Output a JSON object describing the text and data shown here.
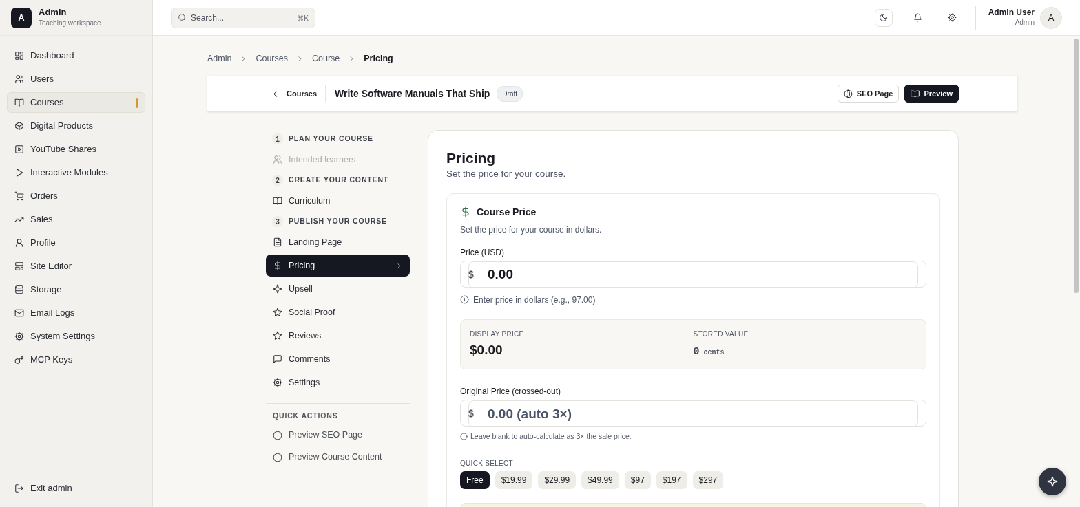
{
  "brand": {
    "logo": "A",
    "name": "Admin",
    "subtitle": "Teaching workspace"
  },
  "sidebar": {
    "items": [
      {
        "label": "Dashboard",
        "selected": false
      },
      {
        "label": "Users",
        "selected": false
      },
      {
        "label": "Courses",
        "selected": true
      },
      {
        "label": "Digital Products",
        "selected": false
      },
      {
        "label": "YouTube Shares",
        "selected": false
      },
      {
        "label": "Interactive Modules",
        "selected": false
      },
      {
        "label": "Orders",
        "selected": false
      },
      {
        "label": "Sales",
        "selected": false
      },
      {
        "label": "Profile",
        "selected": false
      },
      {
        "label": "Site Editor",
        "selected": false
      },
      {
        "label": "Storage",
        "selected": false
      },
      {
        "label": "Email Logs",
        "selected": false
      },
      {
        "label": "System Settings",
        "selected": false
      },
      {
        "label": "MCP Keys",
        "selected": false
      }
    ],
    "footer": {
      "label": "Exit admin"
    }
  },
  "topbar": {
    "search": {
      "placeholder": "Search...",
      "shortcut": "⌘K"
    },
    "user": {
      "name": "Admin User",
      "role": "Admin",
      "avatar": "A"
    }
  },
  "breadcrumb": [
    {
      "label": "Admin",
      "current": false
    },
    {
      "label": "Courses",
      "current": false
    },
    {
      "label": "Course",
      "current": false
    },
    {
      "label": "Pricing",
      "current": true
    }
  ],
  "course_header": {
    "back": "Courses",
    "title": "Write Software Manuals That Ship",
    "status": "Draft",
    "buttons": [
      {
        "label": "SEO Page",
        "primary": false
      },
      {
        "label": "Preview",
        "primary": true
      }
    ]
  },
  "steps": [
    {
      "number": "1",
      "title": "PLAN YOUR COURSE",
      "items": [
        {
          "label": "Intended learners",
          "disabled": true,
          "selected": false
        }
      ]
    },
    {
      "number": "2",
      "title": "CREATE YOUR CONTENT",
      "items": [
        {
          "label": "Curriculum",
          "disabled": false,
          "selected": false
        }
      ]
    },
    {
      "number": "3",
      "title": "PUBLISH YOUR COURSE",
      "items": [
        {
          "label": "Landing Page",
          "disabled": false,
          "selected": false
        },
        {
          "label": "Pricing",
          "disabled": false,
          "selected": true
        },
        {
          "label": "Upsell",
          "disabled": false,
          "selected": false
        },
        {
          "label": "Social Proof",
          "disabled": false,
          "selected": false
        },
        {
          "label": "Reviews",
          "disabled": false,
          "selected": false
        },
        {
          "label": "Comments",
          "disabled": false,
          "selected": false
        },
        {
          "label": "Settings",
          "disabled": false,
          "selected": false
        }
      ]
    }
  ],
  "quick_actions": {
    "title": "QUICK ACTIONS",
    "items": [
      "Preview SEO Page",
      "Preview Course Content"
    ]
  },
  "pricing": {
    "title": "Pricing",
    "subtitle": "Set the price for your course.",
    "course_price": {
      "title": "Course Price",
      "description": "Set the price for your course in dollars.",
      "price": {
        "label": "Price (USD)",
        "prefix": "$",
        "value": "0.00",
        "hint": "Enter price in dollars (e.g., 97.00)"
      },
      "summary": [
        {
          "kind": "display",
          "label": "DISPLAY PRICE",
          "value": "$0.00"
        },
        {
          "kind": "stored",
          "label": "STORED VALUE",
          "value": "0",
          "unit": "cents"
        }
      ],
      "original_price": {
        "label": "Original Price (crossed-out)",
        "prefix": "$",
        "placeholder": "0.00 (auto 3×)",
        "hint": "Leave blank to auto-calculate as 3× the sale price."
      },
      "quick_select": {
        "label": "QUICK SELECT",
        "options": [
          {
            "label": "Free",
            "selected": true
          },
          {
            "label": "$19.99",
            "selected": false
          },
          {
            "label": "$29.99",
            "selected": false
          },
          {
            "label": "$49.99",
            "selected": false
          },
          {
            "label": "$97",
            "selected": false
          },
          {
            "label": "$197",
            "selected": false
          },
          {
            "label": "$297",
            "selected": false
          }
        ]
      }
    }
  }
}
